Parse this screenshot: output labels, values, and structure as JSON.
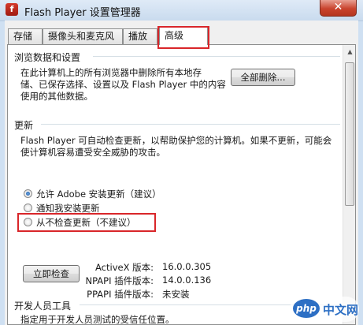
{
  "window": {
    "title": "Flash Player 设置管理器",
    "app_icon_glyph": "f",
    "close_glyph": "✕"
  },
  "tabs": [
    {
      "label": "存储"
    },
    {
      "label": "摄像头和麦克风"
    },
    {
      "label": "播放"
    },
    {
      "label": "高级",
      "active": true
    }
  ],
  "browsing": {
    "heading": "浏览数据和设置",
    "lines": [
      "在此计算机上的所有浏览器中删除所有本地存",
      "储、已保存选择、设置以及 Flash Player 中的内容",
      "使用的其他数据。"
    ],
    "delete_all_button": "全部删除..."
  },
  "updates": {
    "heading": "更新",
    "lines": [
      "Flash Player 可自动检查更新，以帮助保护您的计算机。如果不更新，可能会",
      "使计算机容易遭受安全威胁的攻击。"
    ],
    "options": [
      {
        "label": "允许 Adobe 安装更新（建议）",
        "checked": true
      },
      {
        "label": "通知我安装更新",
        "checked": false
      },
      {
        "label": "从不检查更新（不建议）",
        "checked": false
      }
    ],
    "check_now_button": "立即检查",
    "versions": [
      {
        "label": "ActiveX 版本:",
        "value": "16.0.0.305"
      },
      {
        "label": "NPAPI 插件版本:",
        "value": "14.0.0.136"
      },
      {
        "label": "PPAPI 插件版本:",
        "value": "未安装"
      }
    ]
  },
  "developer": {
    "heading": "开发人员工具",
    "line": "指定用于开发人员测试的受信任位置。"
  },
  "watermark": {
    "badge": "php",
    "text": "中文网"
  },
  "colors": {
    "highlight_red": "#d9262a",
    "accent_blue": "#2d6fc4"
  }
}
